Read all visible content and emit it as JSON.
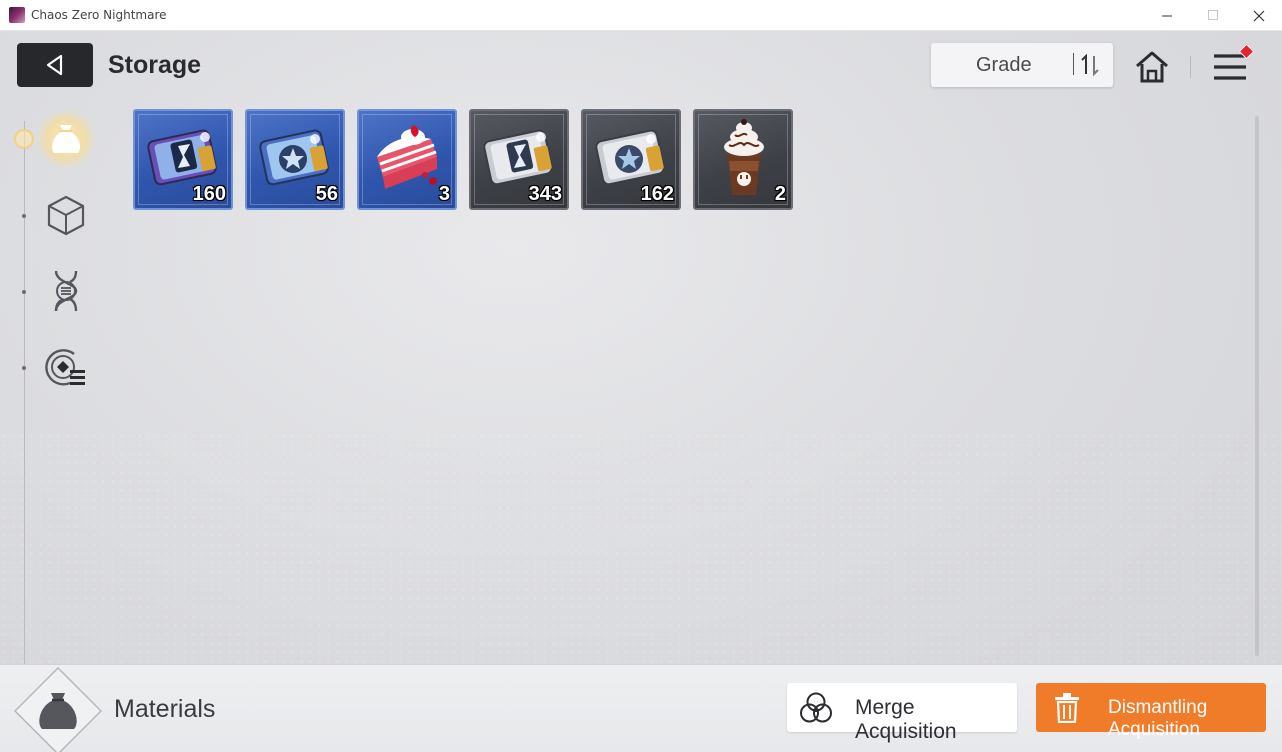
{
  "window": {
    "title": "Chaos Zero Nightmare",
    "controls": [
      "minimize",
      "maximize",
      "close"
    ]
  },
  "header": {
    "title": "Storage",
    "back_icon": "back-triangle-icon",
    "sort": {
      "label": "Grade",
      "icon": "sort-order-icon"
    },
    "home_icon": "home-icon",
    "menu_icon": "hamburger-menu-icon",
    "menu_badge_color": "#e8232f"
  },
  "sidebar": {
    "items": [
      {
        "name": "materials",
        "icon": "pouch-icon",
        "active": true
      },
      {
        "name": "equipment",
        "icon": "cube-icon",
        "active": false
      },
      {
        "name": "genes",
        "icon": "dna-icon",
        "active": false
      },
      {
        "name": "memory",
        "icon": "disc-list-icon",
        "active": false
      }
    ]
  },
  "items": [
    {
      "icon": "hourglass-ticket-icon",
      "quantity": "160",
      "rarity": "blue"
    },
    {
      "icon": "star-ticket-icon",
      "quantity": "56",
      "rarity": "blue"
    },
    {
      "icon": "strawberry-cake-icon",
      "quantity": "3",
      "rarity": "blue"
    },
    {
      "icon": "hourglass-ticket-icon",
      "quantity": "343",
      "rarity": "gray"
    },
    {
      "icon": "star-ticket-icon",
      "quantity": "162",
      "rarity": "gray"
    },
    {
      "icon": "chocolate-frappe-icon",
      "quantity": "2",
      "rarity": "gray"
    }
  ],
  "footer": {
    "category_label": "Materials",
    "category_icon": "pouch-icon",
    "merge_label": "Merge Acquisition",
    "merge_icon": "venn-circles-icon",
    "dismantle_label": "Dismantling Acquisition",
    "dismantle_icon": "trash-icon",
    "dismantle_color": "#f07c2a"
  }
}
